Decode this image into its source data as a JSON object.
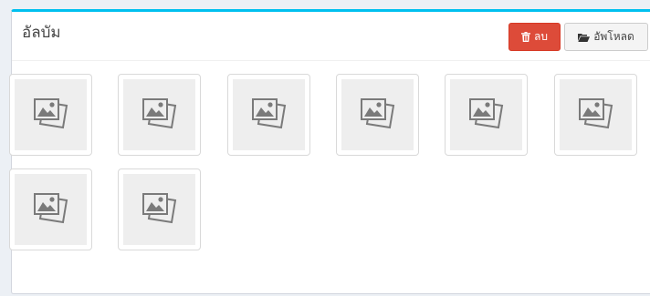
{
  "album": {
    "title": "อัลบัม"
  },
  "toolbar": {
    "delete_label": "ลบ",
    "delete_icon": "trash-icon",
    "upload_label": "อัพโหลด",
    "upload_icon": "folder-open-icon"
  },
  "gallery": {
    "placeholder_icon": "image-placeholder-icon",
    "items": [
      {
        "name": "photo-1"
      },
      {
        "name": "photo-2"
      },
      {
        "name": "photo-3"
      },
      {
        "name": "photo-4"
      },
      {
        "name": "photo-5"
      },
      {
        "name": "photo-6"
      },
      {
        "name": "photo-7"
      },
      {
        "name": "photo-8"
      }
    ]
  },
  "colors": {
    "accent": "#00c0ef",
    "danger": "#dd4b39",
    "default_button": "#f4f4f4",
    "placeholder_bg": "#eeeeee"
  }
}
